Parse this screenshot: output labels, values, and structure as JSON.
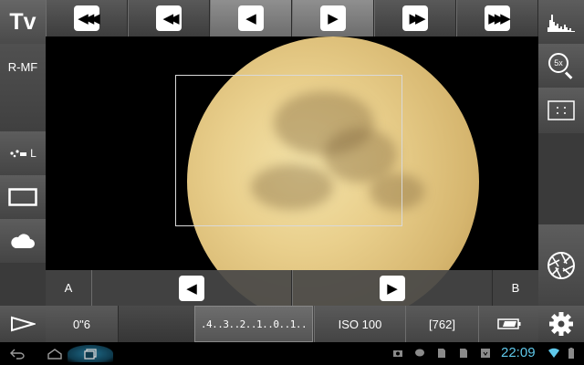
{
  "mode": {
    "label": "Tv"
  },
  "focus_mode": {
    "label": "R-MF"
  },
  "drive": {
    "label": "L"
  },
  "focus_row": {
    "label_a": "A",
    "label_b": "B"
  },
  "bottom": {
    "shutter": "0\"6",
    "exposure_scale": ".4..3..2..1..0..1..",
    "iso": "ISO 100",
    "shots_remaining": "[762]"
  },
  "zoom": {
    "label": "5x"
  },
  "status": {
    "time": "22:09"
  },
  "icons": {
    "focus_nav": [
      "triple-left-icon",
      "double-left-icon",
      "single-left-icon",
      "single-right-icon",
      "double-right-icon",
      "triple-right-icon"
    ],
    "right": [
      "histogram-icon",
      "zoom-magnifier-icon",
      "grid-icon",
      "aperture-shutter-icon",
      "gear-icon"
    ],
    "left": [
      "drive-mode-icon",
      "aspect-ratio-icon",
      "white-balance-cloud-icon",
      "play-icon"
    ]
  },
  "colors": {
    "accent": "#5fc8ea",
    "panel": "#4a4a4a"
  }
}
